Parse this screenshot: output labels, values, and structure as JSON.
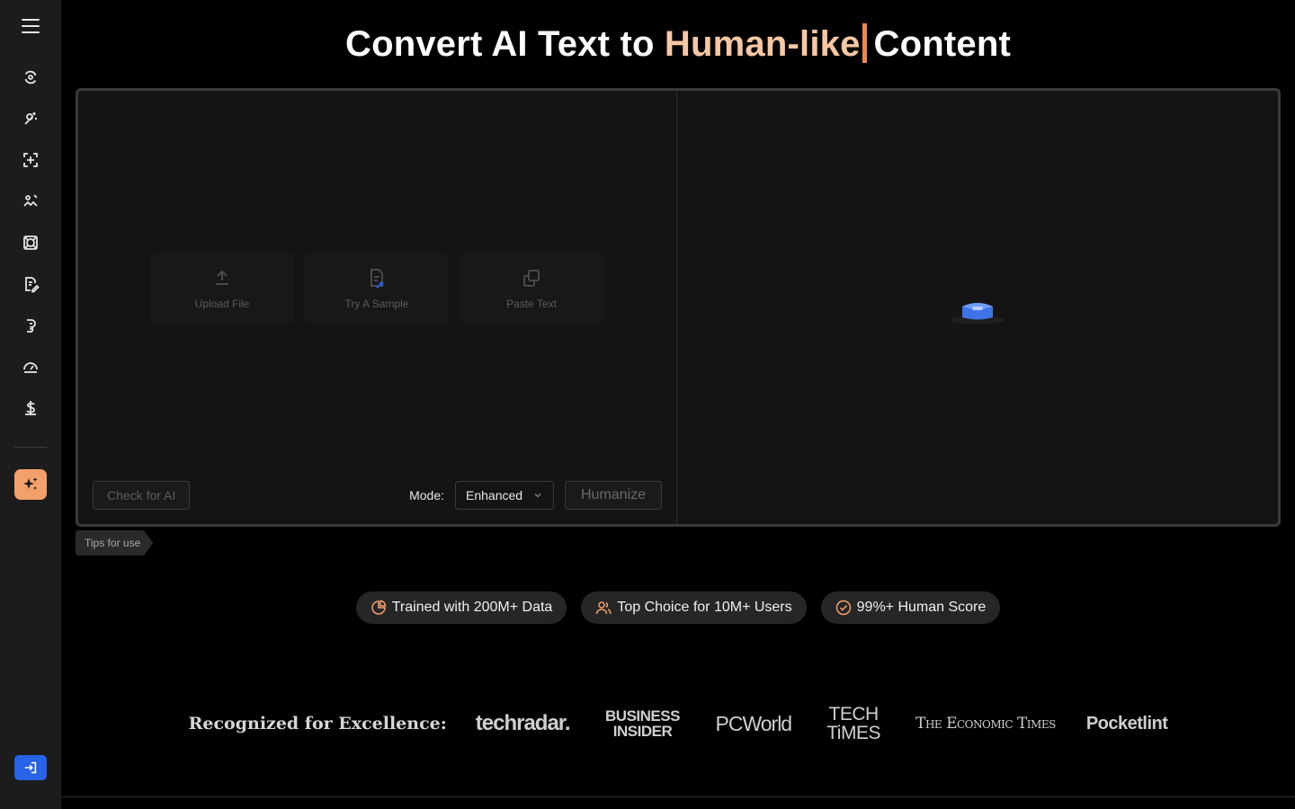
{
  "headline": {
    "prefix": "Convert AI Text to ",
    "accent": "Human-like",
    "suffix": "Content"
  },
  "sidebar": {
    "icons": [
      "refresh-icon",
      "magic-wand-icon",
      "scan-icon",
      "image-edit-icon",
      "target-icon",
      "document-edit-icon",
      "brain-icon",
      "speedometer-icon",
      "dollar-icon"
    ]
  },
  "editor": {
    "actions": {
      "upload": "Upload File",
      "sample": "Try A Sample",
      "paste": "Paste Text"
    },
    "check_ai": "Check for AI",
    "mode_label": "Mode:",
    "mode_value": "Enhanced",
    "humanize": "Humanize"
  },
  "tips": "Tips for use",
  "badges": [
    {
      "label": "Trained with 200M+ Data",
      "icon": "pie-chart-icon"
    },
    {
      "label": "Top Choice for 10M+ Users",
      "icon": "users-icon"
    },
    {
      "label": "99%+ Human Score",
      "icon": "badge-check-icon"
    }
  ],
  "recognition": {
    "label": "Recognized for Excellence:",
    "logos": {
      "techradar": "techradar.",
      "bi_line1": "BUSINESS",
      "bi_line2": "INSIDER",
      "pcworld": "PCWorld",
      "tt_line1": "TECH",
      "tt_line2": "TiMES",
      "et": "The Economic Times",
      "pocket": "Pocketlint"
    }
  },
  "colors": {
    "accent": "#f8c7a4",
    "cursor": "#f4874f",
    "ai_button": "#f4a06a",
    "login_button": "#2763e6"
  }
}
